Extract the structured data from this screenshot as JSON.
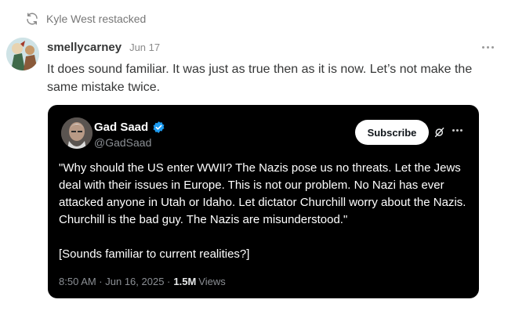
{
  "restack": {
    "icon": "restack-icon",
    "text": "Kyle West restacked"
  },
  "post": {
    "author": "smellycarney",
    "date": "Jun 17",
    "more_icon": "more-horizontal-icon",
    "body": "It does sound familiar. It was just as true then as it is now. Let’s not make the same mistake twice."
  },
  "embed": {
    "name": "Gad Saad",
    "verified_icon": "verified-badge-icon",
    "handle": "@GadSaad",
    "subscribe_label": "Subscribe",
    "x_icon": "x-logo-icon",
    "more_icon": "more-horizontal-icon",
    "quote": "\"Why should the US enter WWII?  The Nazis pose us no threats.  Let the Jews deal with their issues in Europe.  This is not our problem.  No Nazi has ever attacked anyone in Utah or Idaho.  Let dictator Churchill worry about the Nazis.  Churchill is the bad guy.  The Nazis are misunderstood.\"",
    "comment": "[Sounds familiar to current realities?]",
    "timestamp": "8:50 AM · Jun 16, 2025 · ",
    "views_count": "1.5M",
    "views_label": "Views"
  },
  "colors": {
    "card_background": "#000000",
    "verified_blue": "#1d9bf0",
    "subscribe_bg": "#ffffff"
  }
}
